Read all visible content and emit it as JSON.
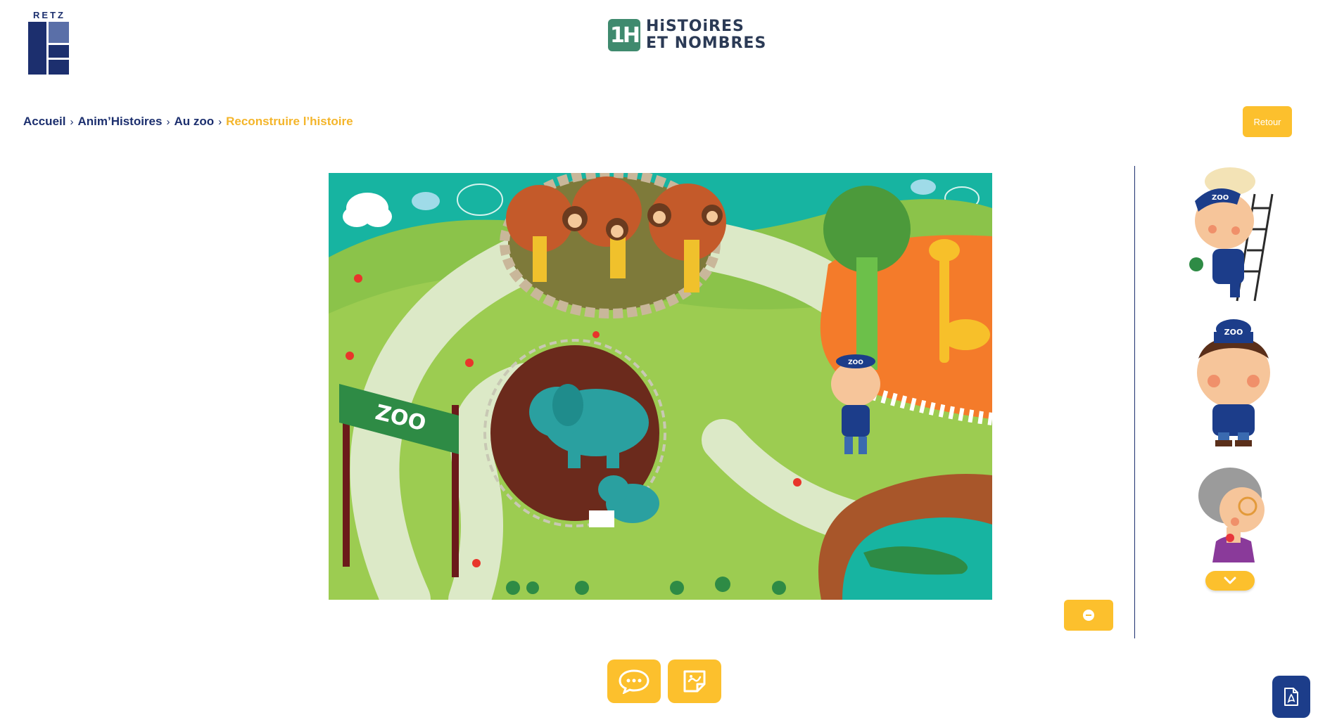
{
  "brand": {
    "publisher": "RETZ",
    "app_badge": "1H",
    "app_title_line1": "HiSTOiRES",
    "app_title_line2": "ET NOMBRES"
  },
  "breadcrumb": {
    "items": [
      "Accueil",
      "Anim’Histoires",
      "Au zoo"
    ],
    "current": "Reconstruire l’histoire",
    "separator": "›"
  },
  "buttons": {
    "back_label": "Retour"
  },
  "scene": {
    "sign_text": "ZOO",
    "cap_text": "ZOO"
  },
  "sidebar": {
    "characters": [
      {
        "name": "zookeeper-with-ladder",
        "cap_text": "ZOO"
      },
      {
        "name": "zookeeper",
        "cap_text": "ZOO"
      },
      {
        "name": "grandmother"
      }
    ]
  },
  "colors": {
    "accent": "#fcc02d",
    "navy": "#1c2f6e",
    "crumb_current": "#f4b52a",
    "scene_bg": "#17b4a1"
  }
}
